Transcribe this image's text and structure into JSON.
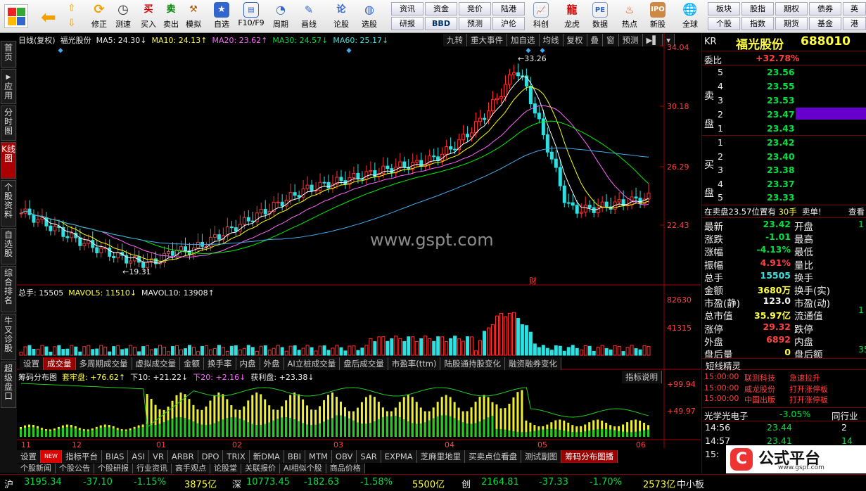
{
  "toolbar": {
    "buttons": [
      "买入",
      "卖出",
      "模拟",
      "自选",
      "F10/F9",
      "周期",
      "画线",
      "论股",
      "选股",
      "科创",
      "龙虎",
      "数据",
      "热点",
      "新股",
      "全球"
    ],
    "top_buttons": [
      "修正",
      "测速"
    ],
    "small": [
      [
        "资讯",
        "资金",
        "竞价",
        "陆港"
      ],
      [
        "研报",
        "BBD",
        "预测",
        "沪伦"
      ]
    ],
    "right_small": [
      [
        "板块",
        "股指",
        "期权",
        "债券",
        "英"
      ],
      [
        "个股",
        "指数",
        "期货",
        "基金",
        "港"
      ]
    ]
  },
  "sidetabs": [
    "首页",
    "应用",
    "分时图",
    "K线图",
    "个股资料",
    "自选股",
    "综合排名",
    "牛叉诊股",
    "超级盘口"
  ],
  "chart": {
    "ma_line": {
      "name": "日线(复权)",
      "stock": "福光股份",
      "ma5": "MA5: 24.30↓",
      "ma10": "MA10: 24.13↑",
      "ma20": "MA20: 23.62↑",
      "ma30": "MA30: 24.57↓",
      "ma60": "MA60: 25.17↓"
    },
    "top_buttons": [
      "九转",
      "重大事件",
      "加自选",
      "均线",
      "复权",
      "叠",
      "窗",
      "预测"
    ],
    "price_axis": [
      "34.04",
      "30.18",
      "26.29",
      "22.43"
    ],
    "high_label": "33.26",
    "low_label": "19.31",
    "cai_label": "财",
    "watermark": "www.gspt.com",
    "vol_line": {
      "total": "总手: 15505",
      "mavol5": "MAVOL5: 11510↓",
      "mavol10": "MAVOL10: 13908↑"
    },
    "vol_axis": [
      "82630",
      "41315"
    ],
    "tabs": [
      "设置",
      "成交量",
      "多周期成交量",
      "虚拟成交量",
      "金额",
      "换手率",
      "内盘",
      "外盘",
      "AI立桩成交量",
      "盘后成交量",
      "市盈率(ttm)",
      "陆股通持股变化",
      "融资融券变化"
    ],
    "chip_line": {
      "name": "筹码分布图",
      "tao": "套牢盘: +76.62↑",
      "xia10": "下10: +21.22↓",
      "xia20": "下20: +2.16↓",
      "huo": "获利盘: +23.38↓"
    },
    "chip_btn": "指标说明",
    "chip_axis": [
      "+99.94",
      "+49.97"
    ],
    "months": [
      "11",
      "12",
      "01",
      "02",
      "03",
      "04",
      "05",
      "06"
    ],
    "ind_tabs": [
      "设置",
      "NEW",
      "指标平台",
      "BIAS",
      "ASI",
      "VR",
      "ARBR",
      "DPO",
      "TRIX",
      "新DMA",
      "BBI",
      "MTM",
      "OBV",
      "SAR",
      "EXPMA",
      "芝麻里地里",
      "买卖点位看盘",
      "测试副图",
      "筹码分布图播"
    ],
    "bottom_tabs": [
      "个股新闻",
      "个股公告",
      "个股研报",
      "行业资讯",
      "高手观点",
      "论股堂",
      "关联报价",
      "AI相似个股",
      "商品价格"
    ]
  },
  "quote": {
    "code": "KR",
    "name": "福光股份",
    "num": "688010",
    "weibi_label": "委比",
    "weibi": "+32.78%",
    "sell_label": "卖盘",
    "buy_label": "买盘",
    "sell": [
      [
        "5",
        "23.56"
      ],
      [
        "4",
        "23.55"
      ],
      [
        "3",
        "23.53"
      ],
      [
        "2",
        "23.47"
      ],
      [
        "1",
        "23.43"
      ]
    ],
    "buy": [
      [
        "1",
        "23.42"
      ],
      [
        "2",
        "23.40"
      ],
      [
        "3",
        "23.38"
      ],
      [
        "4",
        "23.37"
      ],
      [
        "5",
        "23.33"
      ]
    ],
    "note": "在卖盘23.57位置有",
    "note_vol": "30手",
    "note_tag": "卖单!",
    "note_more": "查看",
    "stats": [
      [
        "最新",
        "23.42",
        "开盘"
      ],
      [
        "涨跌",
        "-1.01",
        "最高"
      ],
      [
        "涨幅",
        "-4.13%",
        "最低"
      ],
      [
        "振幅",
        "4.91%",
        "量比"
      ],
      [
        "总手",
        "15505",
        "换手"
      ],
      [
        "金额",
        "3680万",
        "换手(实)"
      ],
      [
        "市盈(静)",
        "123.0",
        "市盈(动)"
      ],
      [
        "总市值",
        "35.97亿",
        "流通值"
      ],
      [
        "涨停",
        "29.32",
        "跌停"
      ],
      [
        "外盘",
        "6892",
        "内盘"
      ],
      [
        "盘后量",
        "0",
        "盘后额"
      ]
    ],
    "stat_cols": [
      "1",
      "1",
      "35."
    ],
    "jingling": "短线精灵",
    "news": [
      [
        "15:00:00",
        "联测科技",
        "急速拉升"
      ],
      [
        "15:00:00",
        "威龙股份",
        "打开涨停板"
      ],
      [
        "15:00:00",
        "中国出版",
        "打开涨停板"
      ]
    ],
    "sector": "光学光电子",
    "sector_pct": "-3.05%",
    "sector_link": "同行业",
    "ticks": [
      [
        "14:56",
        "23.44",
        "2"
      ],
      [
        "14:57",
        "23.41",
        "14"
      ],
      [
        "15:",
        "",
        " "
      ]
    ],
    "logo": "公式平台",
    "logo_url": "www.gspt.com"
  },
  "status": {
    "sh": [
      "沪",
      "3195.34",
      "-37.10",
      "-1.15%",
      "3875亿"
    ],
    "sz": [
      "深",
      "10773.45",
      "-182.63",
      "-1.58%",
      "5500亿"
    ],
    "cy": [
      "创",
      "2164.81",
      "-37.33",
      "-1.70%",
      "2573亿"
    ],
    "tail": "中小板"
  }
}
